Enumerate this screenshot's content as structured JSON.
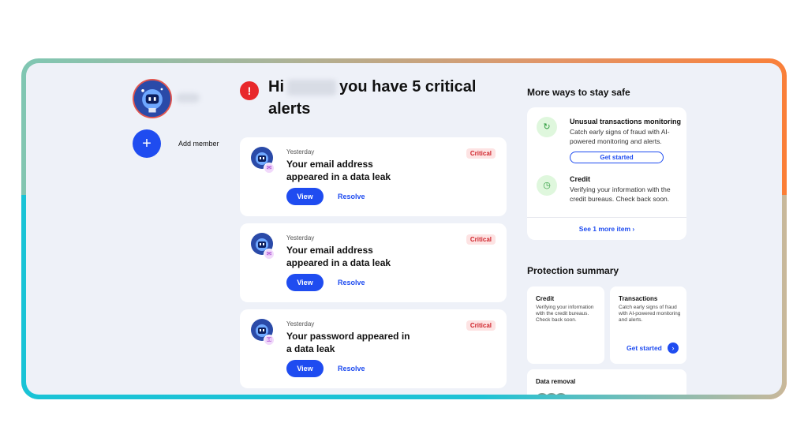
{
  "sidebar": {
    "add_member_label": "Add member",
    "add_icon": "+"
  },
  "header": {
    "greeting_prefix": "Hi",
    "greeting_suffix": "you have 5 critical",
    "greeting_line2": "alerts",
    "alert_icon": "!"
  },
  "alerts": [
    {
      "when": "Yesterday",
      "title": "Your email address appeared in a data leak",
      "badge": "Critical",
      "view": "View",
      "resolve": "Resolve",
      "sub_icon": "✉"
    },
    {
      "when": "Yesterday",
      "title": "Your email address appeared in a data leak",
      "badge": "Critical",
      "view": "View",
      "resolve": "Resolve",
      "sub_icon": "✉"
    },
    {
      "when": "Yesterday",
      "title": "Your password appeared in a data leak",
      "badge": "Critical",
      "view": "View",
      "resolve": "Resolve",
      "sub_icon": "⚿"
    }
  ],
  "more_ways": {
    "title": "More ways to stay safe",
    "items": [
      {
        "title": "Unusual transactions monitoring",
        "desc": "Catch early signs of fraud with AI-powered monitoring and alerts.",
        "button": "Get started"
      },
      {
        "title": "Credit",
        "desc": "Verifying your information with the credit bureaus. Check back soon."
      }
    ],
    "see_more": "See 1 more item  ›"
  },
  "protection": {
    "title": "Protection summary",
    "credit": {
      "title": "Credit",
      "desc": "Verifying your information with the credit bureaus. Check back soon."
    },
    "transactions": {
      "title": "Transactions",
      "desc": "Catch early signs of fraud with AI-powered monitoring and alerts.",
      "link": "Get started",
      "arrow": "›"
    },
    "data_removal": {
      "title": "Data removal"
    }
  },
  "colors": {
    "accent": "#1f4cf0",
    "critical": "#d0242b",
    "bg": "#eef1f8"
  }
}
